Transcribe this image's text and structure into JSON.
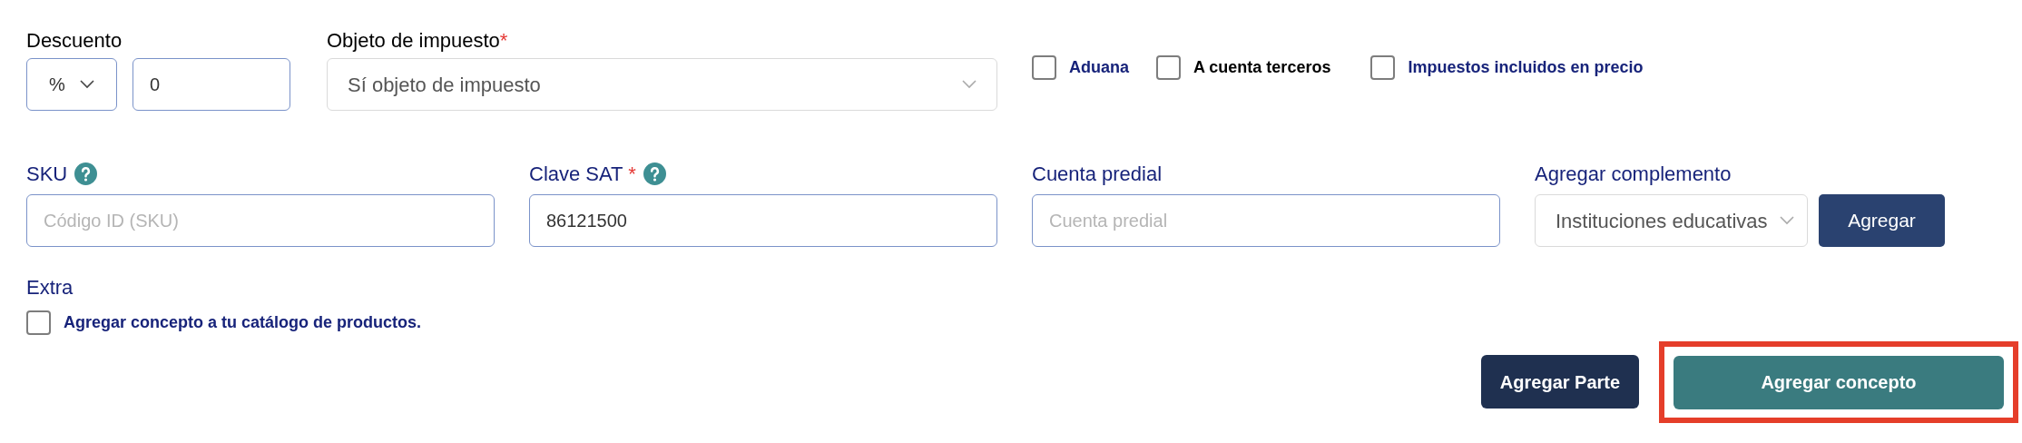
{
  "discount": {
    "label": "Descuento",
    "type_select": {
      "value": "%"
    },
    "amount": {
      "value": "0"
    }
  },
  "tax_object": {
    "label": "Objeto de impuesto",
    "required_mark": "*",
    "select": {
      "value": "Sí objeto de impuesto"
    }
  },
  "options": [
    {
      "label": "Aduana",
      "checked": false,
      "kind": "link"
    },
    {
      "label": "A cuenta terceros",
      "checked": false,
      "kind": "plain"
    },
    {
      "label": "Impuestos incluidos en precio",
      "checked": false,
      "kind": "link"
    }
  ],
  "fields": [
    {
      "kind": "input",
      "label": "SKU",
      "help": true,
      "placeholder": "Código ID (SKU)"
    },
    {
      "kind": "input",
      "label": "Clave SAT",
      "required_mark": "*",
      "help": true,
      "value": "86121500"
    },
    {
      "kind": "input",
      "label": "Cuenta predial",
      "placeholder": "Cuenta predial"
    },
    {
      "kind": "select_button",
      "label": "Agregar complemento",
      "value": "Instituciones educativas",
      "button": "Agregar"
    }
  ],
  "extra": {
    "label": "Extra",
    "catalog_option": {
      "label": "Agregar concepto a tu catálogo de productos.",
      "checked": false
    }
  },
  "actions": [
    {
      "label": "Agregar Parte",
      "kind": "secondary",
      "highlighted": false
    },
    {
      "label": "Agregar concepto",
      "kind": "primary",
      "highlighted": true
    }
  ]
}
